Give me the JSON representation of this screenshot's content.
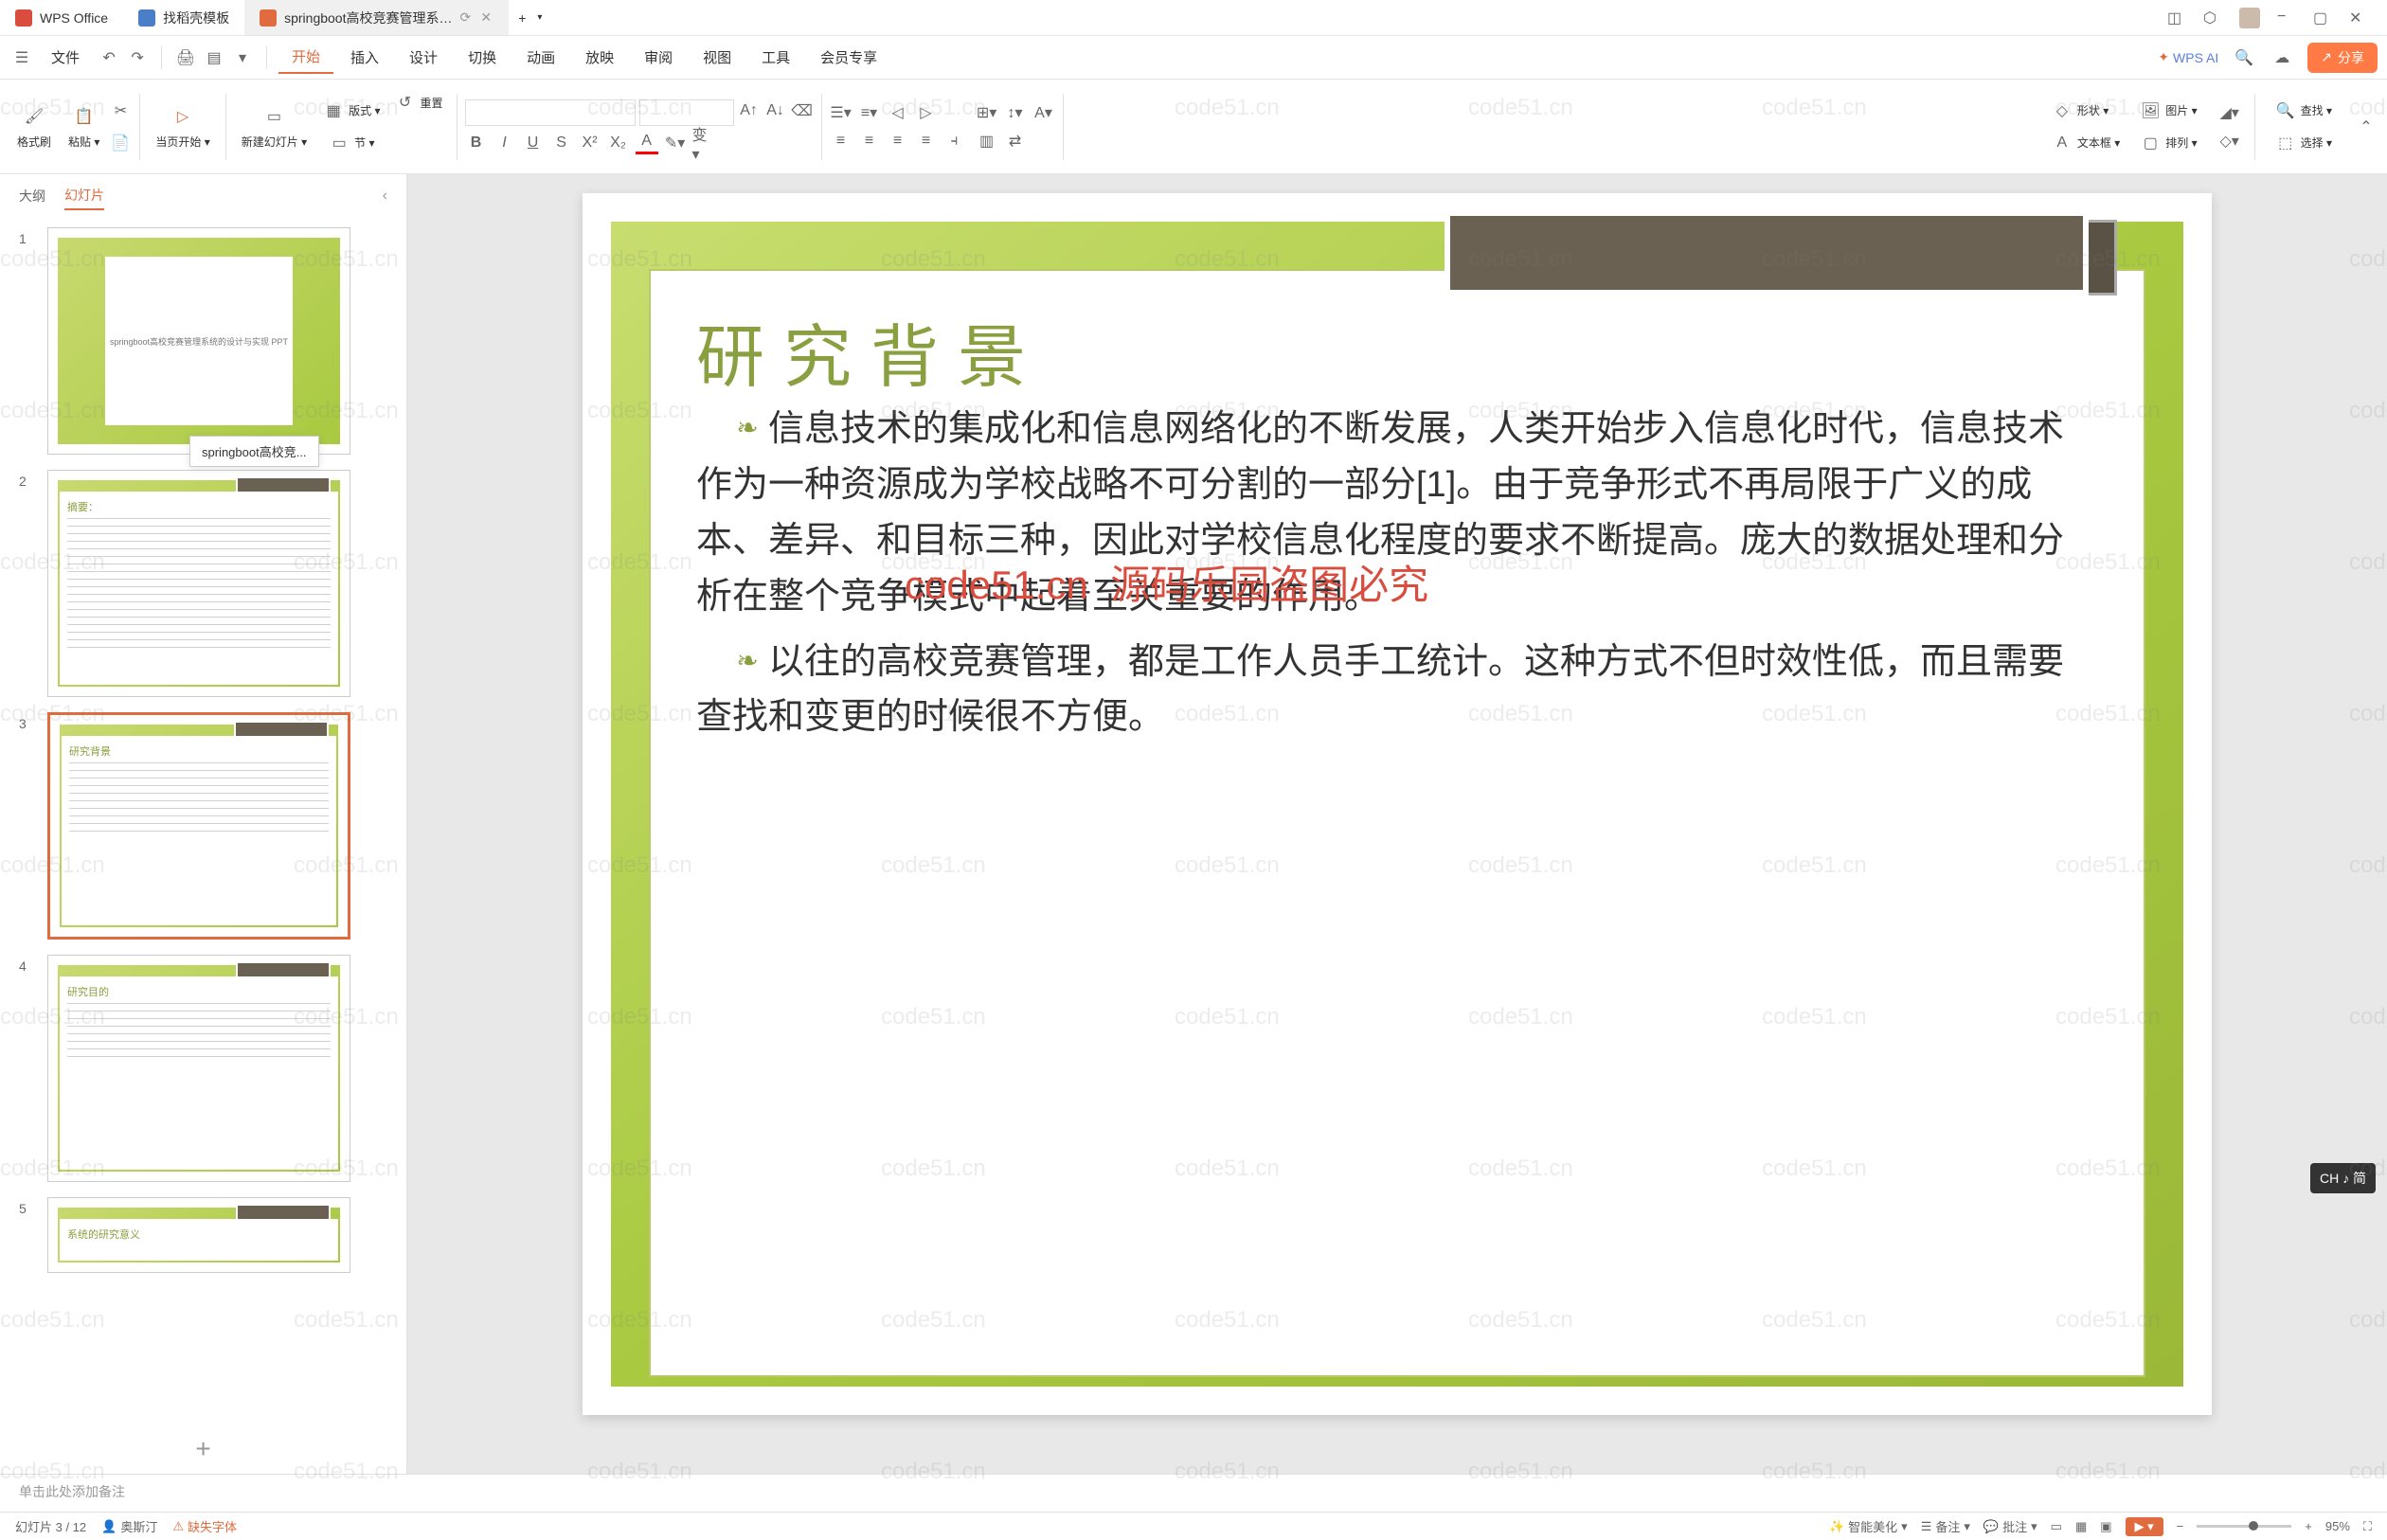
{
  "titleBar": {
    "tabs": [
      {
        "label": "WPS Office",
        "icon": "wps"
      },
      {
        "label": "找稻壳模板",
        "icon": "doc"
      },
      {
        "label": "springboot高校竞赛管理系…",
        "icon": "ppt",
        "active": true
      }
    ],
    "tooltip": "springboot高校竞..."
  },
  "menuBar": {
    "fileLabel": "文件",
    "items": [
      "开始",
      "插入",
      "设计",
      "切换",
      "动画",
      "放映",
      "审阅",
      "视图",
      "工具",
      "会员专享"
    ],
    "activeIndex": 0,
    "wpsAi": "WPS AI",
    "shareLabel": "分享"
  },
  "ribbon": {
    "format": "格式刷",
    "paste": "粘贴",
    "fromCurrent": "当页开始",
    "newSlide": "新建幻灯片",
    "layout": "版式",
    "section": "节",
    "reset": "重置",
    "shape": "形状",
    "picture": "图片",
    "textbox": "文本框",
    "arrange": "排列",
    "find": "查找",
    "select": "选择"
  },
  "slidePanel": {
    "tabs": [
      "大纲",
      "幻灯片"
    ],
    "activeTab": 1,
    "slides": [
      {
        "num": "1",
        "title": "springboot高校竞赛管理系统的设计与实现 PPT"
      },
      {
        "num": "2",
        "title": "摘要："
      },
      {
        "num": "3",
        "title": "研究背景",
        "selected": true
      },
      {
        "num": "4",
        "title": "研究目的"
      },
      {
        "num": "5",
        "title": "系统的研究意义"
      }
    ]
  },
  "slide": {
    "heading": "研究背景",
    "para1": "信息技术的集成化和信息网络化的不断发展，人类开始步入信息化时代，信息技术作为一种资源成为学校战略不可分割的一部分[1]。由于竞争形式不再局限于广义的成本、差异、和目标三种，因此对学校信息化程度的要求不断提高。庞大的数据处理和分析在整个竞争模式中起着至关重要的作用。",
    "para2": "以往的高校竞赛管理，都是工作人员手工统计。这种方式不但时效性低，而且需要查找和变更的时候很不方便。",
    "watermarkRed1": "code51.cn",
    "watermarkRed2": "源码乐园盗图必究"
  },
  "notes": {
    "placeholder": "单击此处添加备注"
  },
  "statusBar": {
    "slideCount": "幻灯片 3 / 12",
    "author": "奥斯汀",
    "missingFont": "缺失字体",
    "beautify": "智能美化",
    "notes": "备注",
    "review": "批注",
    "zoom": "95%"
  },
  "ime": {
    "label": "CH ♪ 简"
  },
  "watermark": "code51.cn"
}
